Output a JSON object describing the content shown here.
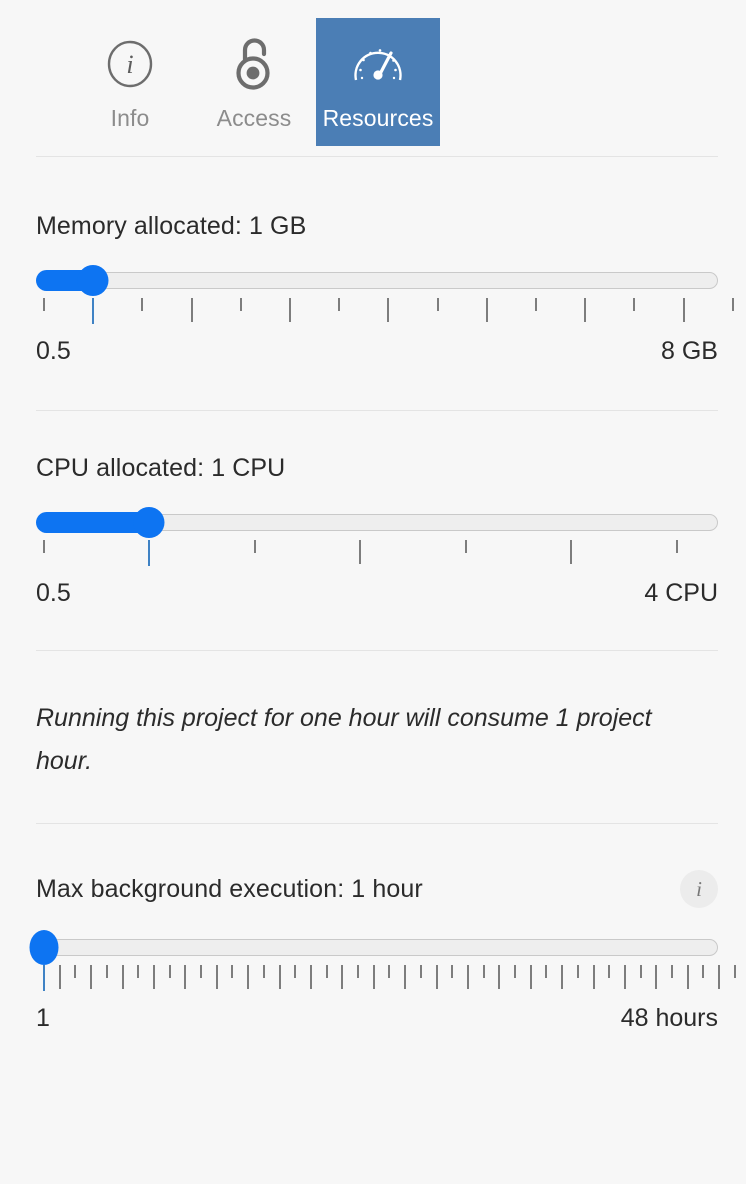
{
  "theme": {
    "background": "#f7f7f7",
    "accent_blue": "#0d74f2",
    "tab_active_blue": "#4b7eb5",
    "text": "#2b2b2b",
    "muted_text": "#8c8c8c",
    "track": "#eeeeee",
    "tick": "#7d7d7d"
  },
  "tabs": [
    {
      "label": "Info",
      "icon": "info-circle-icon",
      "active": false
    },
    {
      "label": "Access",
      "icon": "open-padlock-icon",
      "active": false
    },
    {
      "label": "Resources",
      "icon": "gauge-speedometer-icon",
      "active": true
    }
  ],
  "memory": {
    "title": "Memory allocated: 1 GB",
    "value": 1,
    "min": 0.5,
    "max": 8,
    "step": 0.5,
    "min_label": "0.5",
    "max_label": "8 GB",
    "unit": "GB"
  },
  "cpu": {
    "title": "CPU allocated: 1 CPU",
    "value": 1,
    "min": 0.5,
    "max": 4,
    "step": 0.5,
    "min_label": "0.5",
    "max_label": "4 CPU",
    "unit": "CPU"
  },
  "note": {
    "text": "Running this project for one hour will consume 1 project hour."
  },
  "background_execution": {
    "title": "Max background execution: 1 hour",
    "value": 1,
    "min": 1,
    "max": 48,
    "step": 1,
    "min_label": "1",
    "max_label": "48 hours",
    "unit": "hours",
    "info_glyph": "i"
  }
}
